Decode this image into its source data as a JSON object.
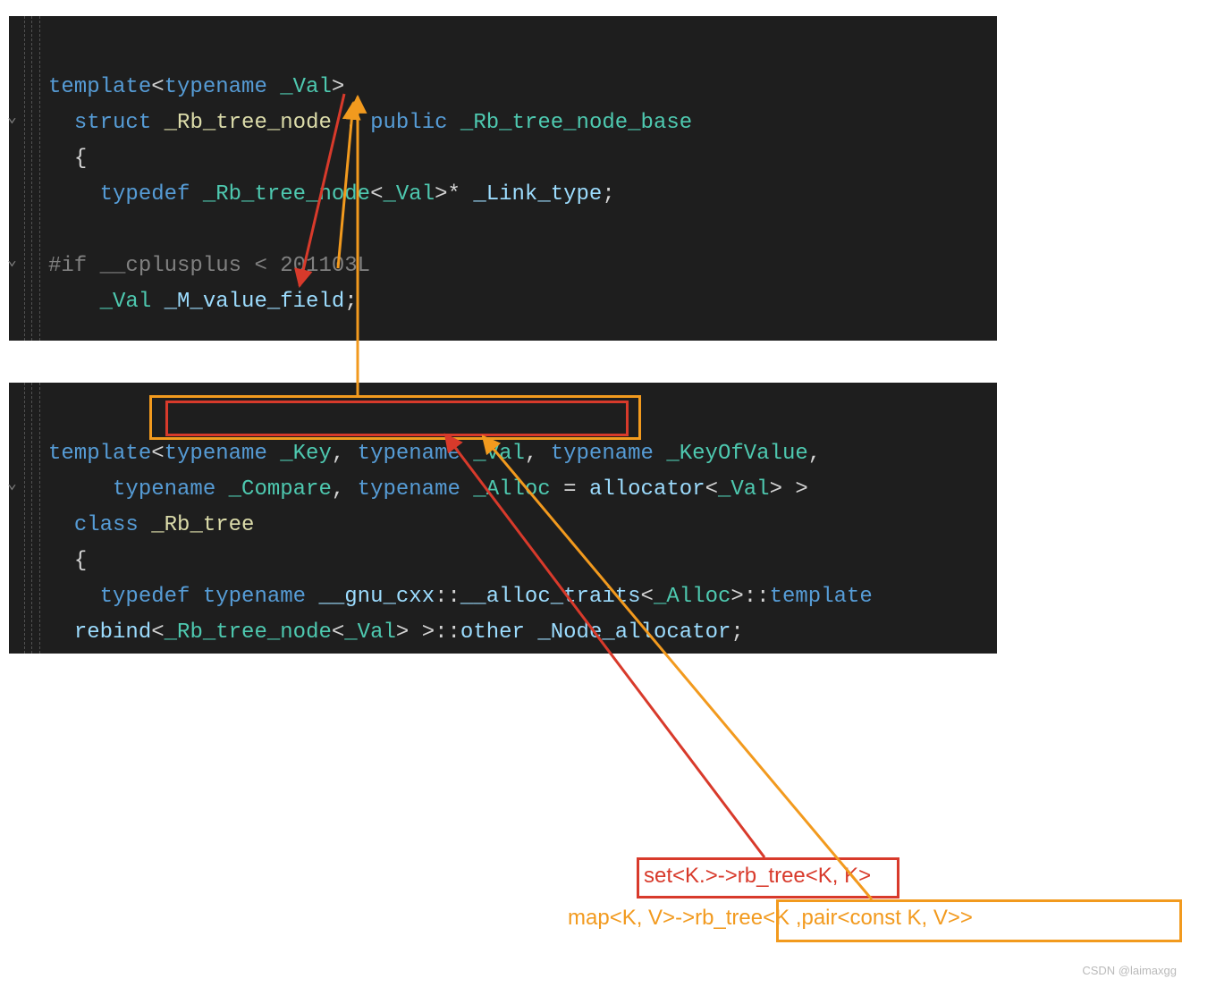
{
  "block1": {
    "l1_template": "template",
    "l1_open": "<",
    "l1_typename": "typename",
    "l1_val": "_Val",
    "l1_close": ">",
    "l2_struct": "struct",
    "l2_name": "_Rb_tree_node",
    "l2_colon_public": " : ",
    "l2_public": "public",
    "l2_base": "_Rb_tree_node_base",
    "l3_brace": "{",
    "l4_typedef": "typedef",
    "l4_type": "_Rb_tree_node",
    "l4_open": "<",
    "l4_val": "_Val",
    "l4_close": ">",
    "l4_star": "*",
    "l4_link": "_Link_type",
    "l4_semi": ";",
    "l6_pp": "#if __cplusplus < 201103L",
    "l7_val": "_Val",
    "l7_field": "_M_value_field",
    "l7_semi": ";"
  },
  "block2": {
    "l1_template": "template",
    "l1_open": "<",
    "l1_tn1": "typename",
    "l1_key": "_Key",
    "l1_c1": ", ",
    "l1_tn2": "typename",
    "l1_val": "_Val",
    "l1_c2": ", ",
    "l1_tn3": "typename",
    "l1_kov": "_KeyOfValue",
    "l1_c3": ",",
    "l2_tn": "typename",
    "l2_comp": "_Compare",
    "l2_c": ", ",
    "l2_tn2": "typename",
    "l2_alloc": "_Alloc",
    "l2_eq": " = ",
    "l2_allocator": "allocator",
    "l2_open": "<",
    "l2_val": "_Val",
    "l2_close": ">",
    "l2_sp_close": " >",
    "l3_class": "class",
    "l3_name": "_Rb_tree",
    "l4_brace": "{",
    "l5_typedef": "typedef",
    "l5_tn": "typename",
    "l5_gnu": "__gnu_cxx",
    "l5_dc": "::",
    "l5_at": "__alloc_traits",
    "l5_open": "<",
    "l5_alloc": "_Alloc",
    "l5_close": ">",
    "l5_dc2": "::",
    "l5_tmpl": "template",
    "l6_rebind": "rebind",
    "l6_open": "<",
    "l6_rbtn": "_Rb_tree_node",
    "l6_open2": "<",
    "l6_val": "_Val",
    "l6_close2": ">",
    "l6_sp": " ",
    "l6_close": ">",
    "l6_dc": "::",
    "l6_other": "other",
    "l6_na": "_Node_allocator",
    "l6_semi": ";"
  },
  "annot": {
    "set": "set<K.>->rb_tree<K, K>",
    "map": "map<K, V>->rb_tree<K ,pair<const K, V>>"
  },
  "watermark": "CSDN @laimaxgg"
}
